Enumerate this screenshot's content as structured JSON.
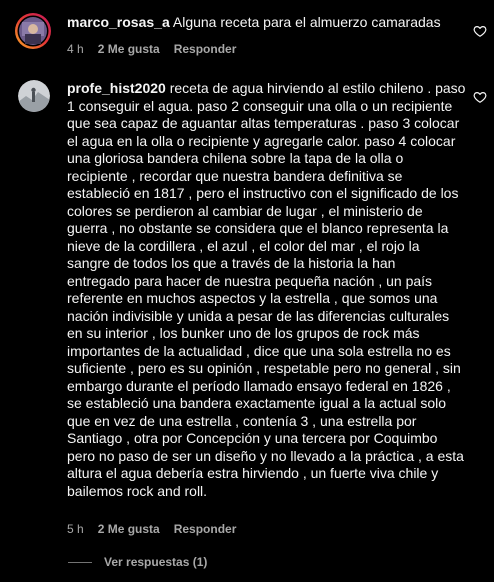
{
  "comments": [
    {
      "username": "marco_rosas_a",
      "text": "Alguna receta para el almuerzo camaradas",
      "time": "4 h",
      "likes": "2 Me gusta",
      "reply_label": "Responder"
    },
    {
      "username": "profe_hist2020",
      "lines": [
        "receta de agua hirviendo al estilo chileno . paso",
        "1 conseguir el agua. paso 2 conseguir una olla o un recipiente",
        "que sea capaz de aguantar altas temperaturas . paso 3 colocar",
        "el agua en la olla o recipiente y agregarle calor. paso 4 colocar",
        "una gloriosa bandera chilena sobre la tapa de la olla o",
        "recipiente , recordar que nuestra bandera definitiva se",
        "estableció en 1817 , pero el instructivo con el significado de los",
        "colores se perdieron al cambiar de lugar , el ministerio de",
        "guerra , no obstante se considera que el blanco representa la",
        "nieve de la cordillera , el azul , el color del mar , el rojo la",
        "sangre de todos los que a través de la historia la han",
        "entregado para hacer de nuestra pequeña nación , un país",
        "referente en muchos aspectos y la estrella , que somos una",
        "nación indivisible y unida a pesar de las diferencias culturales",
        "en su interior , los bunker uno de los grupos de rock más",
        "importantes de la actualidad , dice que una sola estrella no es",
        "suficiente , pero es su opinión , respetable pero no general , sin",
        "embargo durante el período llamado ensayo federal en 1826 ,",
        "se estableció una bandera exactamente igual a la actual solo",
        "que en vez de una estrella , contenía 3 , una estrella por",
        "Santiago , otra por Concepción y una tercera por Coquimbo",
        "pero no paso de ser un diseño y no llevado a la práctica , a esta",
        "altura el agua debería estra hirviendo , un fuerte viva chile y",
        "bailemos rock and roll."
      ],
      "time": "5 h",
      "likes": "2 Me gusta",
      "reply_label": "Responder"
    }
  ],
  "replies_label": "Ver respuestas (1)",
  "icons": {
    "like": "heart-outline-icon"
  },
  "colors": {
    "background": "#000000",
    "text": "#f5f5f5",
    "muted": "#a8a8a8",
    "story_ring_start": "#f9a825",
    "story_ring_end": "#c2185b"
  }
}
